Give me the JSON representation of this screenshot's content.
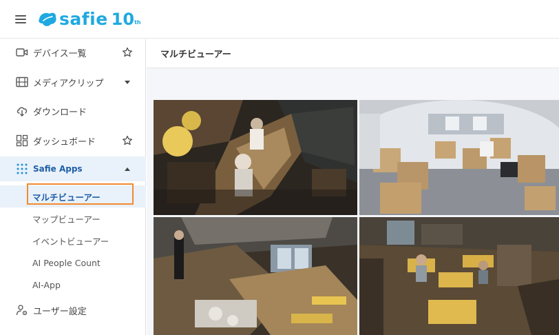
{
  "app": {
    "logo_text": "safie",
    "logo_number": "10",
    "logo_sup": "th"
  },
  "sidebar": {
    "items": [
      {
        "label": "デバイス一覧",
        "icon": "video-camera-icon",
        "trail": "star-icon"
      },
      {
        "label": "メディアクリップ",
        "icon": "film-icon",
        "trail": "caret-down-icon"
      },
      {
        "label": "ダウンロード",
        "icon": "download-cloud-icon"
      },
      {
        "label": "ダッシュボード",
        "icon": "dashboard-grid-icon",
        "trail": "star-icon"
      }
    ],
    "apps": {
      "label": "Safie Apps",
      "icon": "dots-grid-icon",
      "trail": "caret-up-icon",
      "sub_items": [
        {
          "label": "マルチビューアー",
          "active": true
        },
        {
          "label": "マップビューアー"
        },
        {
          "label": "イベントビューアー"
        },
        {
          "label": "AI People Count"
        },
        {
          "label": "AI-App"
        }
      ]
    },
    "user_settings": {
      "label": "ユーザー設定",
      "icon": "user-gear-icon"
    }
  },
  "main": {
    "title": "マルチビューアー"
  },
  "colors": {
    "brand": "#1fa9e1",
    "active_text": "#1f5fa6",
    "active_bg": "#e9f1fa",
    "highlight": "#f28a2f"
  }
}
